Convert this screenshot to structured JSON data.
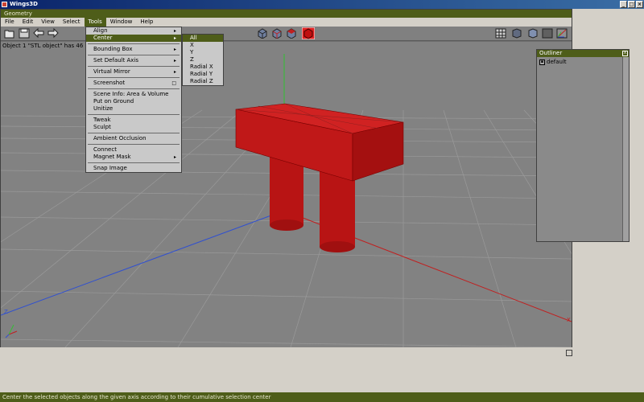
{
  "window": {
    "title": "Wings3D"
  },
  "geometry": {
    "title": "Geometry"
  },
  "menubar": [
    "File",
    "Edit",
    "View",
    "Select",
    "Tools",
    "Window",
    "Help"
  ],
  "info_text": "Object 1 \"STL object\" has 46",
  "tools_menu": [
    {
      "label": "Align",
      "arrow": "▸"
    },
    {
      "label": "Center",
      "arrow": "▸",
      "highlight": true
    },
    {
      "sep": true
    },
    {
      "label": "Bounding Box",
      "arrow": "▸"
    },
    {
      "sep": true
    },
    {
      "label": "Set Default Axis",
      "arrow": "▸"
    },
    {
      "sep": true
    },
    {
      "label": "Virtual Mirror",
      "arrow": "▸"
    },
    {
      "sep": true
    },
    {
      "label": "Screenshot",
      "arrow": "□"
    },
    {
      "sep": true
    },
    {
      "label": "Scene Info: Area & Volume"
    },
    {
      "label": "Put on Ground"
    },
    {
      "label": "Unitize"
    },
    {
      "sep": true
    },
    {
      "label": "Tweak"
    },
    {
      "label": "Sculpt"
    },
    {
      "sep": true
    },
    {
      "label": "Ambient Occlusion"
    },
    {
      "sep": true
    },
    {
      "label": "Connect"
    },
    {
      "label": "Magnet Mask",
      "arrow": "▸"
    },
    {
      "sep": true
    },
    {
      "label": "Snap Image"
    }
  ],
  "center_submenu": [
    {
      "label": "All",
      "highlight": true
    },
    {
      "label": "X"
    },
    {
      "label": "Y"
    },
    {
      "label": "Z"
    },
    {
      "label": "Radial X"
    },
    {
      "label": "Radial Y"
    },
    {
      "label": "Radial Z"
    }
  ],
  "outliner": {
    "title": "Outliner",
    "close": "X",
    "item": "default"
  },
  "status": "Center the selected objects along the given axis according to their cumulative selection center",
  "axis_labels": {
    "z": "Z",
    "x": "X"
  },
  "colors": {
    "panel_title": "#4e5d19",
    "object_red": "#c01818",
    "axis_x": "#c02020",
    "axis_y": "#30c030",
    "axis_z": "#3050d0"
  }
}
